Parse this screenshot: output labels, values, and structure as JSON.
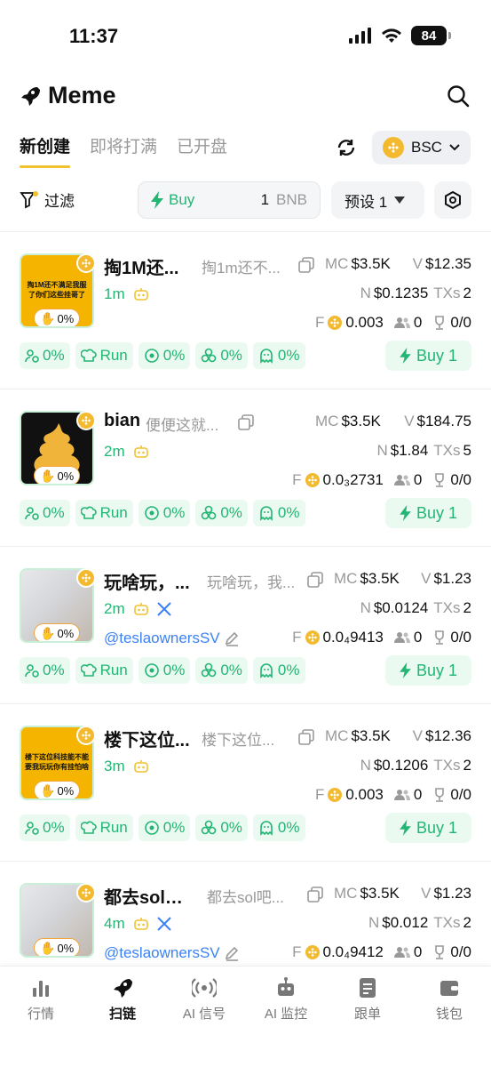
{
  "status": {
    "time": "11:37",
    "battery": "84"
  },
  "header": {
    "title": "Meme"
  },
  "tabs": [
    "新创建",
    "即将打满",
    "已开盘"
  ],
  "chain": {
    "label": "BSC"
  },
  "filter": {
    "label": "过滤"
  },
  "buy_box": {
    "label": "Buy",
    "amount": "1",
    "unit": "BNB"
  },
  "preset": {
    "label": "预设 1"
  },
  "card_common": {
    "mc_key": "MC",
    "v_key": "V",
    "n_key": "N",
    "txs_key": "TXs",
    "f_key": "F",
    "pct": "0%",
    "run": "Run",
    "buy": "Buy 1"
  },
  "cards": [
    {
      "name": "掏1M还...",
      "desc": "掏1m还不...",
      "mc": "$3.5K",
      "v": "$12.35",
      "age": "1m",
      "n": "$0.1235",
      "txs": "2",
      "fee": "0.003",
      "holders": "0",
      "trophy": "0/0",
      "img_text": "掏1M还不满足我服了你们这些挂哥了",
      "handle": ""
    },
    {
      "name": "bian",
      "desc": "便便这就...",
      "mc": "$3.5K",
      "v": "$184.75",
      "age": "2m",
      "n": "$1.84",
      "txs": "5",
      "fee": "0.0₃2731",
      "holders": "0",
      "trophy": "0/0",
      "img_text": "",
      "handle": ""
    },
    {
      "name": "玩啥玩，...",
      "desc": "玩啥玩，我...",
      "mc": "$3.5K",
      "v": "$1.23",
      "age": "2m",
      "n": "$0.0124",
      "txs": "2",
      "fee": "0.0₄9413",
      "holders": "0",
      "trophy": "0/0",
      "img_text": "",
      "handle": "@teslaownersSV"
    },
    {
      "name": "楼下这位...",
      "desc": "楼下这位...",
      "mc": "$3.5K",
      "v": "$12.36",
      "age": "3m",
      "n": "$0.1206",
      "txs": "2",
      "fee": "0.003",
      "holders": "0",
      "trophy": "0/0",
      "img_text": "楼下这位科技能不能要我玩玩你有挂怕啥",
      "handle": ""
    },
    {
      "name": "都去sol吧...",
      "desc": "都去sol吧...",
      "mc": "$3.5K",
      "v": "$1.23",
      "age": "4m",
      "n": "$0.012",
      "txs": "2",
      "fee": "0.0₄9412",
      "holders": "0",
      "trophy": "0/0",
      "img_text": "",
      "handle": "@teslaownersSV"
    }
  ],
  "nav": [
    "行情",
    "扫链",
    "AI 信号",
    "AI 监控",
    "跟单",
    "钱包"
  ],
  "colors": {
    "accent_green": "#22b573",
    "brand_yellow": "#f2c12e",
    "bnb": "#f3ba2f",
    "link_blue": "#3b82f6"
  }
}
